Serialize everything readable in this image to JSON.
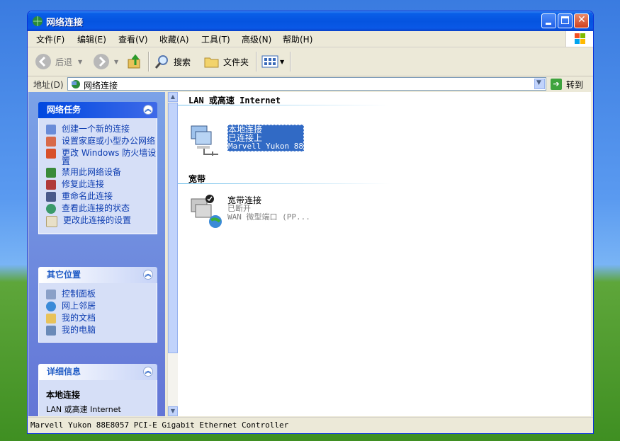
{
  "window": {
    "title": "网络连接"
  },
  "menu": [
    "文件(F)",
    "编辑(E)",
    "查看(V)",
    "收藏(A)",
    "工具(T)",
    "高级(N)",
    "帮助(H)"
  ],
  "toolbar": {
    "back": "后退",
    "search": "搜索",
    "folders": "文件夹"
  },
  "address": {
    "label": "地址(D)",
    "value": "网络连接",
    "go": "转到"
  },
  "left": {
    "network_tasks": {
      "title": "网络任务",
      "items": [
        "创建一个新的连接",
        "设置家庭或小型办公网络",
        "更改 Windows 防火墙设置",
        "禁用此网络设备",
        "修复此连接",
        "重命名此连接",
        "查看此连接的状态",
        "更改此连接的设置"
      ]
    },
    "other_places": {
      "title": "其它位置",
      "items": [
        "控制面板",
        "网上邻居",
        "我的文档",
        "我的电脑"
      ]
    },
    "details": {
      "title": "详细信息",
      "name": "本地连接",
      "type": "LAN 或高速 Internet"
    }
  },
  "main": {
    "cat_lan": "LAN 或高速 Internet",
    "cat_broadband": "宽带",
    "lan_conn": {
      "name": "本地连接",
      "status": "已连接上",
      "device": "Marvell Yukon 88"
    },
    "bb_conn": {
      "name": "宽带连接",
      "status": "已断开",
      "device": "WAN 微型端口 (PP..."
    }
  },
  "status": "Marvell Yukon 88E8057 PCI-E Gigabit Ethernet Controller"
}
